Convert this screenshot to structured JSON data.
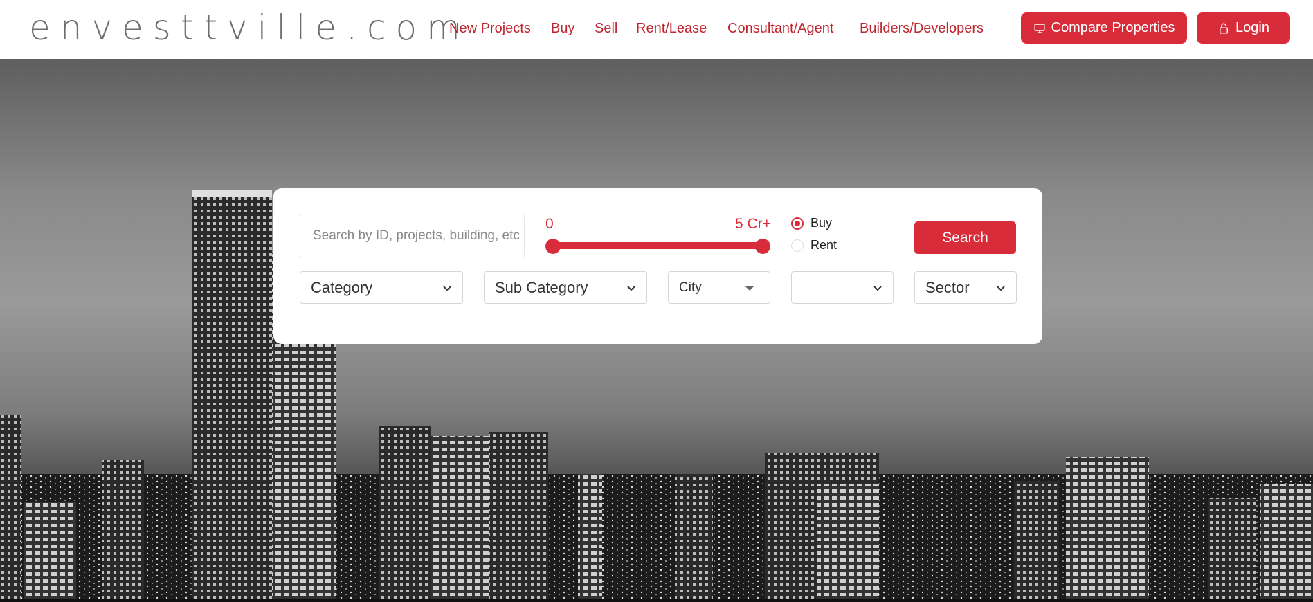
{
  "header": {
    "logo": "envesttville.com",
    "nav": [
      "New Projects",
      "Buy",
      "Sell",
      "Rent/Lease",
      "Consultant/Agent",
      "Builders/Developers"
    ],
    "compare_label": "Compare Properties",
    "login_label": "Login"
  },
  "search": {
    "placeholder": "Search by ID, projects, building, etc",
    "range_min": "0",
    "range_max": "5 Cr+",
    "radio_options": [
      "Buy",
      "Rent"
    ],
    "selected_option": "Buy",
    "search_label": "Search",
    "filters": {
      "category": "Category",
      "sub_category": "Sub Category",
      "city": "City",
      "unnamed": "",
      "sector": "Sector"
    }
  },
  "colors": {
    "accent": "#d92c3a",
    "nav_text": "#c0252f",
    "logo_text": "#6e6e6e"
  },
  "icons": {
    "compare": "monitor-icon",
    "login": "lock-icon",
    "dropdown": "chevron-down-icon"
  }
}
